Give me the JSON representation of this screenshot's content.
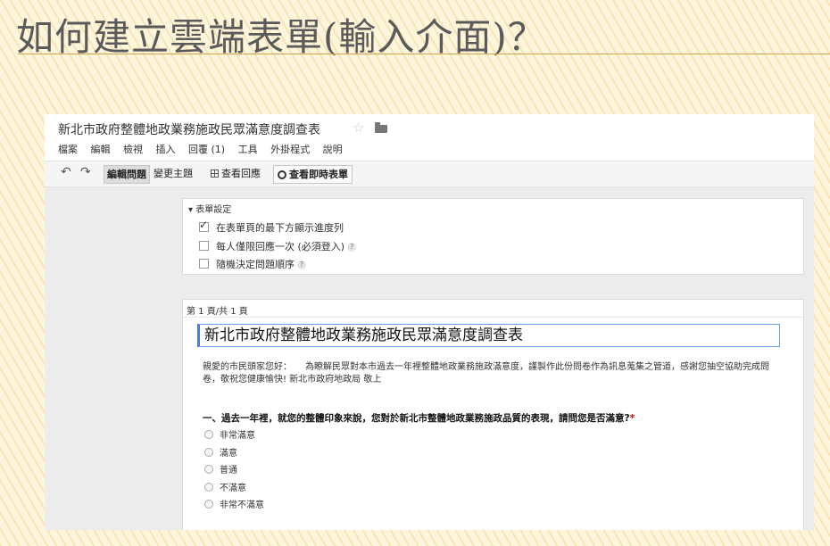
{
  "slide": {
    "title": "如何建立雲端表單(輸入介面)？"
  },
  "app": {
    "doc_title": "新北市政府整體地政業務施政民眾滿意度調查表",
    "menu": [
      "檔案",
      "編輯",
      "檢視",
      "插入",
      "回覆 (1)",
      "工具",
      "外掛程式",
      "說明"
    ],
    "toolbar": {
      "undo": "↶",
      "redo": "↷",
      "edit": "編輯問題",
      "theme": "變更主題",
      "responses": "查看回應",
      "live": "查看即時表單"
    }
  },
  "settings": {
    "tab_label": "▾ 表單設定",
    "options": [
      {
        "label": "在表單頁的最下方顯示進度列",
        "checked": true
      },
      {
        "label": "每人僅限回應一次 (必須登入)",
        "checked": false,
        "help": "?"
      },
      {
        "label": "隨機決定問題順序",
        "checked": false,
        "help": "?"
      }
    ]
  },
  "form": {
    "page_label": "第 1 頁/共 1 頁",
    "title_value": "新北市政府整體地政業務施政民眾滿意度調查表",
    "description": "親愛的市民頭家您好：　　為瞭解民眾對本市過去一年裡整體地政業務施政滿意度，謹製作此份問卷作為訊息蒐集之管道，感謝您抽空協助完成問卷，敬祝您健康愉快! 新北市政府地政局 敬上",
    "question": "一、過去一年裡，就您的整體印象來說，您對於新北市整體地政業務施政品質的表現，請問您是否滿意?",
    "required_mark": "*",
    "choices": [
      "非常滿意",
      "滿意",
      "普通",
      "不滿意",
      "非常不滿意"
    ]
  }
}
